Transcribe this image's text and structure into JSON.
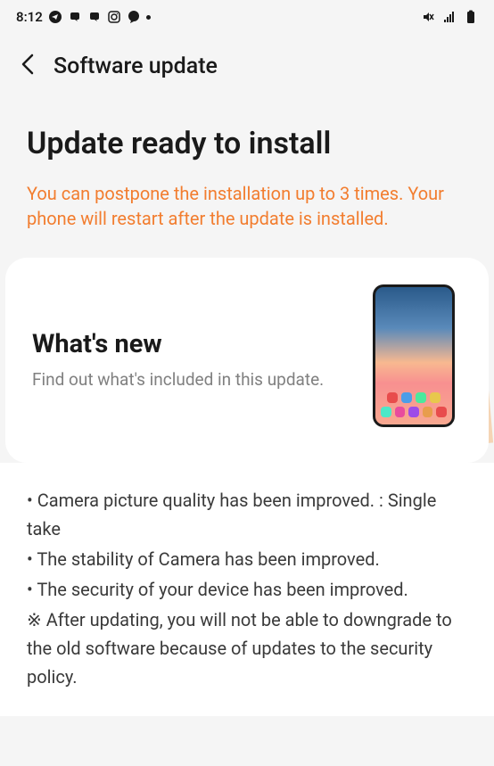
{
  "status_bar": {
    "time": "8:12"
  },
  "header": {
    "title": "Software update"
  },
  "main": {
    "title": "Update ready to install",
    "warning": "You can postpone the installation up to 3 times. Your phone will restart after the update is installed."
  },
  "whats_new": {
    "title": "What's new",
    "subtitle": "Find out what's included in this update."
  },
  "changes": [
    "• Camera picture quality has been improved. : Single take",
    "• The stability of Camera has been improved.",
    "• The security of your device has been improved.",
    "※ After updating, you will not be able to downgrade to the old software because of updates to the security policy."
  ]
}
